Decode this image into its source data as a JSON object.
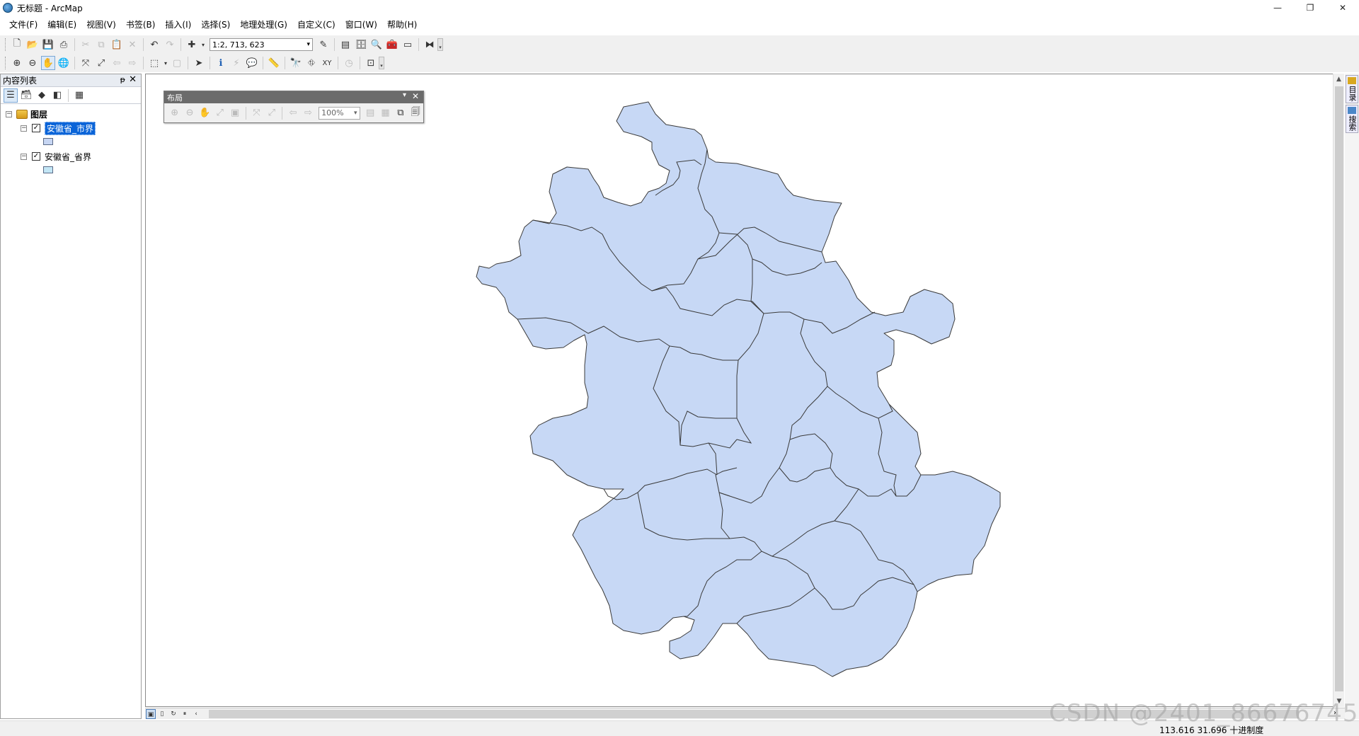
{
  "window": {
    "title": "无标题 - ArcMap",
    "controls": [
      "—",
      "❐",
      "✕"
    ]
  },
  "menu": [
    "文件(F)",
    "编辑(E)",
    "视图(V)",
    "书签(B)",
    "插入(I)",
    "选择(S)",
    "地理处理(G)",
    "自定义(C)",
    "窗口(W)",
    "帮助(H)"
  ],
  "toolbar": {
    "scale": "1:2, 713, 623"
  },
  "toc": {
    "title": "内容列表",
    "pin": "ᵽ",
    "close": "✕",
    "root_label": "图层",
    "layers": [
      {
        "label": "安徽省_市界",
        "checked": "✓",
        "selected": true,
        "fill": "#c7d6f3"
      },
      {
        "label": "安徽省_省界",
        "checked": "✓",
        "selected": false,
        "fill": "#c3e6f5"
      }
    ]
  },
  "layout_toolbar": {
    "title": "布局",
    "zoom": "100%"
  },
  "side_dock": {
    "tabs": [
      "目录",
      "搜索"
    ]
  },
  "map": {
    "fill": "#c7d8f5",
    "stroke": "#3a3a3a"
  },
  "status": {
    "coords": "113.616  31.696 十进制度"
  },
  "watermark": "CSDN @2401_86676745"
}
